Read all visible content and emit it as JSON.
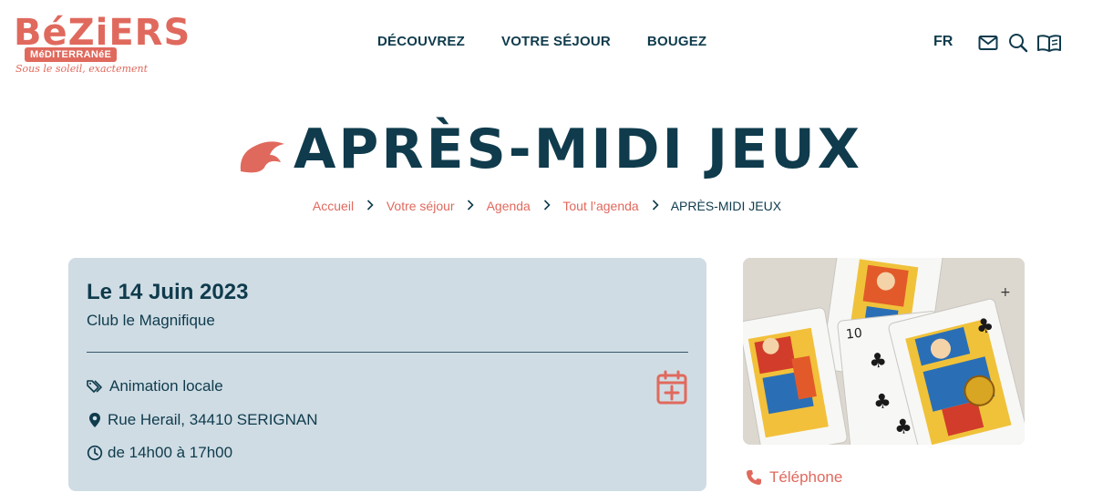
{
  "logo": {
    "name": "BéZiERS",
    "badge": "MéDITERRANéE",
    "tagline": "Sous le soleil, exactement"
  },
  "nav": {
    "items": [
      "DÉCOUVREZ",
      "VOTRE SÉJOUR",
      "BOUGEZ"
    ],
    "language": "FR",
    "icons": [
      "mail-icon",
      "search-icon",
      "brochure-icon"
    ]
  },
  "page": {
    "title": "APRÈS-MIDI JEUX"
  },
  "breadcrumb": {
    "items": [
      "Accueil",
      "Votre séjour",
      "Agenda",
      "Tout l’agenda"
    ],
    "current": "APRÈS-MIDI JEUX"
  },
  "event": {
    "date": "Le 14 Juin 2023",
    "venue": "Club le Magnifique",
    "category": "Animation locale",
    "address": "Rue Herail, 34410 SERIGNAN",
    "hours": "de 14h00 à 17h00"
  },
  "contact": {
    "phone_label": "Téléphone"
  },
  "colors": {
    "primary": "#0f3b4c",
    "accent": "#e0695d",
    "card_bg": "#cfdce4"
  }
}
